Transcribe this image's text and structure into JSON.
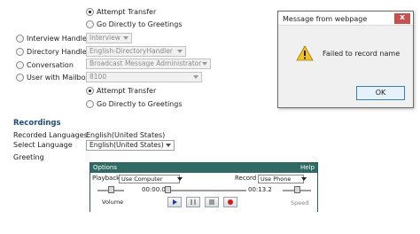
{
  "transfer_top": {
    "attempt_transfer": "Attempt Transfer",
    "go_directly": "Go Directly to Greetings"
  },
  "handlers": [
    {
      "label": "Interview Handler",
      "value": "Interview"
    },
    {
      "label": "Directory Handler",
      "value": "English-DirectoryHandler"
    },
    {
      "label": "Conversation",
      "value": "Broadcast Message Administrator"
    },
    {
      "label": "User with Mailbox",
      "value": "8100"
    }
  ],
  "transfer_bottom": {
    "attempt_transfer": "Attempt Transfer",
    "go_directly": "Go Directly to Greetings"
  },
  "recordings": {
    "title": "Recordings",
    "recorded_languages_label": "Recorded Languages:",
    "recorded_languages_value": "English(United States)",
    "select_language_label": "Select Language",
    "select_language_value": "English(United States)",
    "greeting_label": "Greeting"
  },
  "player": {
    "options": "Options",
    "help": "Help",
    "playback_label": "Playback",
    "playback_value": "Use Computer",
    "record_label": "Record",
    "record_value": "Use Phone",
    "current_time": "00:00.0",
    "total_time": "00:13.2",
    "volume_label": "Volume",
    "speed_label": "Speed"
  },
  "dialog": {
    "title": "Message from webpage",
    "message": "Failed to record name",
    "ok_label": "OK",
    "close_glyph": "x"
  },
  "colors": {
    "section_title": "#1f4b7a",
    "player_bar": "#2f6b64",
    "warning": "#f2c12e",
    "dialog_close": "#c75050"
  }
}
